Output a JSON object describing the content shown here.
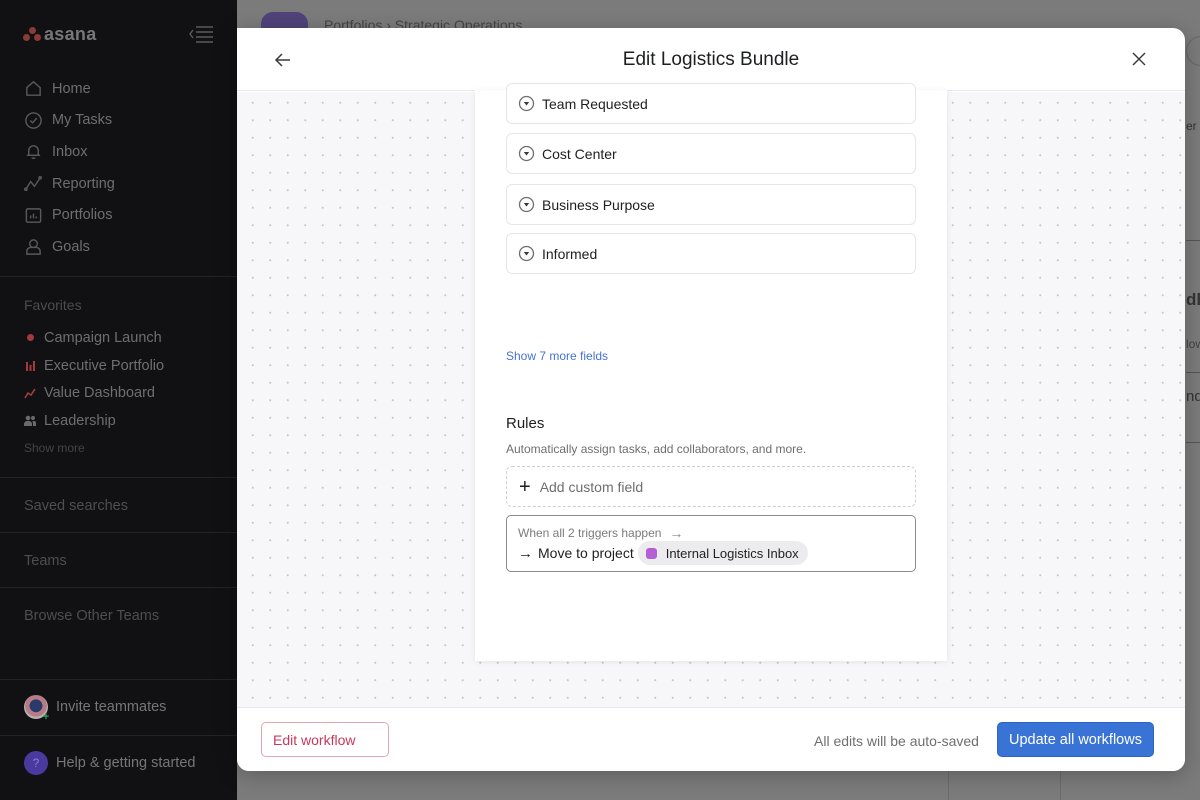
{
  "sidebar": {
    "logo_text": "asana",
    "nav": [
      {
        "label": "Home",
        "icon": "home-icon"
      },
      {
        "label": "My Tasks",
        "icon": "check-circle-icon"
      },
      {
        "label": "Inbox",
        "icon": "bell-icon"
      },
      {
        "label": "Reporting",
        "icon": "trend-line-icon"
      },
      {
        "label": "Portfolios",
        "icon": "portfolio-folder-icon"
      },
      {
        "label": "Goals",
        "icon": "goal-person-icon"
      }
    ],
    "favorites_title": "Favorites",
    "favorites": [
      {
        "label": "Campaign Launch",
        "icon": "project-dot-icon",
        "color": "#a33a3c"
      },
      {
        "label": "Executive Portfolio",
        "icon": "bar-chart-icon",
        "color": "#a33a3c"
      },
      {
        "label": "Value Dashboard",
        "icon": "line-chart-icon",
        "color": "#a33a3c"
      },
      {
        "label": "Leadership",
        "icon": "people-icon",
        "color": "#6a6a6d"
      }
    ],
    "show_more": "Show more",
    "saved_searches": "Saved searches",
    "teams": "Teams",
    "browse_teams": "Browse Other Teams",
    "invite": "Invite teammates",
    "help": "Help & getting started",
    "help_icon_glyph": "?"
  },
  "background": {
    "breadcrumb": "Portfolios  ›  Strategic Operations",
    "fragments": [
      "er",
      "dle",
      "low",
      "nd"
    ]
  },
  "modal": {
    "title": "Edit Logistics Bundle",
    "fields": [
      {
        "label": "Team Requested"
      },
      {
        "label": "Cost Center"
      },
      {
        "label": "Business Purpose"
      },
      {
        "label": "Informed"
      }
    ],
    "show_more_fields": "Show 7 more fields",
    "rules": {
      "title": "Rules",
      "description": "Automatically assign tasks, add collaborators, and more.",
      "add_field": "Add custom field",
      "rule": {
        "trigger": "When all 2 triggers happen",
        "action": "Move to project",
        "project": "Internal Logistics Inbox",
        "project_color": "#b45fd6"
      }
    },
    "footer": {
      "edit_workflow": "Edit workflow",
      "autosave_note": "All edits will be auto-saved",
      "update_all": "Update all workflows"
    }
  },
  "colors": {
    "primary_button": "#3a73d6",
    "link": "#4573d2",
    "danger_text": "#c7385a"
  }
}
